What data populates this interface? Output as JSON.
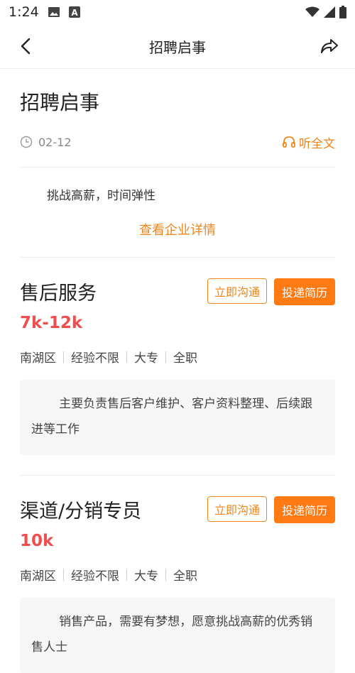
{
  "status_bar": {
    "time": "1:24",
    "icons": [
      "image-icon",
      "font-a-icon",
      "wifi-icon",
      "signal-icon",
      "battery-icon"
    ],
    "badge": "A"
  },
  "nav": {
    "title": "招聘启事",
    "back_icon": "chevron-left-icon",
    "share_icon": "share-icon"
  },
  "article": {
    "title": "招聘启事",
    "date": "02-12",
    "listen_label": "听全文",
    "intro": "挑战高薪，时间弹性",
    "company_link": "查看企业详情"
  },
  "jobs": [
    {
      "title": "售后服务",
      "salary": "7k-12k",
      "tags": [
        "南湖区",
        "经验不限",
        "大专",
        "全职"
      ],
      "chat_label": "立即沟通",
      "apply_label": "投递简历",
      "description": "主要负责售后客户维护、客户资料整理、后续跟进等工作"
    },
    {
      "title": "渠道/分销专员",
      "salary": "10k",
      "tags": [
        "南湖区",
        "经验不限",
        "大专",
        "全职"
      ],
      "chat_label": "立即沟通",
      "apply_label": "投递简历",
      "description": "销售产品，需要有梦想，愿意挑战高薪的优秀销售人士"
    }
  ],
  "colors": {
    "accent": "#f08519",
    "accent_fill": "#ff7a12",
    "salary": "#f04e4e",
    "desc_bg": "#f6f6f6"
  }
}
